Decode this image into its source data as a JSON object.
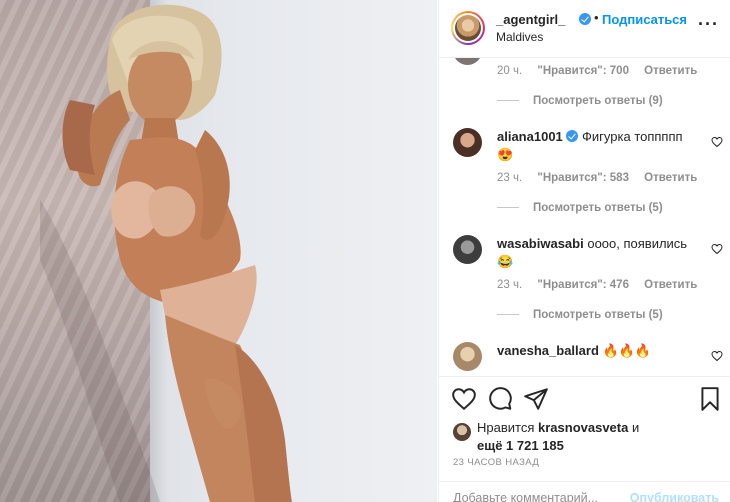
{
  "post": {
    "username": "_agentgirl_",
    "follow_label": "Подписаться",
    "separator": "•",
    "location": "Maldives",
    "more_icon": "more-horizontal-icon"
  },
  "comments": [
    {
      "time": "20 ч.",
      "likes": "\"Нравится\": 700",
      "reply_label": "Ответить",
      "view_replies": "Посмотреть ответы (9)"
    },
    {
      "username": "aliana1001",
      "text": "Фигурка топпппп",
      "emoji": "😍",
      "time": "23 ч.",
      "likes": "\"Нравится\": 583",
      "reply_label": "Ответить",
      "view_replies": "Посмотреть ответы (5)"
    },
    {
      "username": "wasabiwasabi",
      "text": "оооо, появились",
      "emoji": "😂",
      "time": "23 ч.",
      "likes": "\"Нравится\": 476",
      "reply_label": "Ответить",
      "view_replies": "Посмотреть ответы (5)"
    },
    {
      "username": "vanesha_ballard",
      "text": "🔥🔥🔥"
    }
  ],
  "actions": {
    "likes_prefix": "Нравится",
    "likes_user": "krasnovasveta",
    "likes_and": "и",
    "likes_more": "ещё 1 721 185",
    "time_ago": "23 ЧАСОВ НАЗАД",
    "comment_placeholder": "Добавьте комментарий...",
    "publish_label": "Опубликовать"
  },
  "colors": {
    "accent": "#0095f6",
    "verified": "#3897f0",
    "muted": "#8e8e8e",
    "border": "#efefef"
  }
}
